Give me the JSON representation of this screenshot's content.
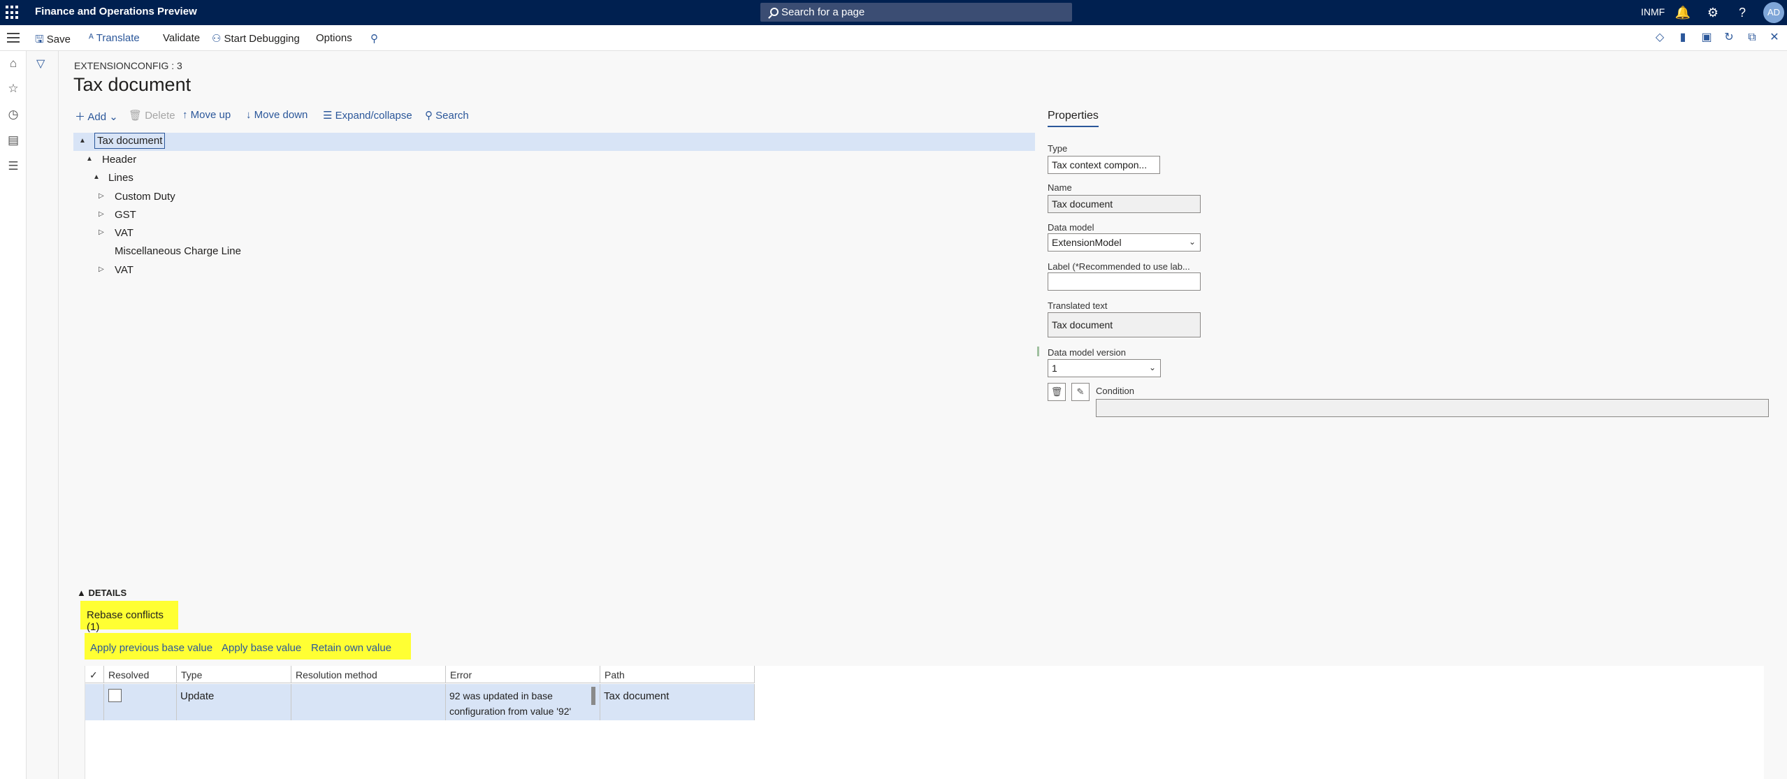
{
  "app": {
    "title": "Finance and Operations Preview",
    "search_placeholder": "Search for a page",
    "company": "INMF",
    "user_initials": "AD"
  },
  "actions": {
    "save": "Save",
    "translate": "Translate",
    "validate": "Validate",
    "start_debugging": "Start Debugging",
    "options": "Options"
  },
  "breadcrumb": "EXTENSIONCONFIG : 3",
  "page_title": "Tax document",
  "tree_toolbar": {
    "add": "Add",
    "delete": "Delete",
    "move_up": "Move up",
    "move_down": "Move down",
    "expand_collapse": "Expand/collapse",
    "search": "Search"
  },
  "tree": [
    {
      "label": "Tax document",
      "expander": "▲",
      "selected": true
    },
    {
      "label": "Header",
      "expander": "▲"
    },
    {
      "label": "Lines",
      "expander": "▲"
    },
    {
      "label": "Custom Duty",
      "expander": "▷"
    },
    {
      "label": "GST",
      "expander": "▷"
    },
    {
      "label": "VAT",
      "expander": "▷"
    },
    {
      "label": "Miscellaneous Charge Line",
      "expander": ""
    },
    {
      "label": "VAT",
      "expander": "▷"
    }
  ],
  "properties": {
    "tab": "Properties",
    "type_label": "Type",
    "type_value": "Tax context compon...",
    "name_label": "Name",
    "name_value": "Tax document",
    "data_model_label": "Data model",
    "data_model_value": "ExtensionModel",
    "label_label": "Label (*Recommended to use lab...",
    "label_value": "",
    "translated_label": "Translated text",
    "translated_value": "Tax document",
    "version_label": "Data model version",
    "version_value": "1",
    "condition_label": "Condition",
    "condition_value": ""
  },
  "details": {
    "header": "DETAILS",
    "tab": "Rebase conflicts (1)",
    "buttons": {
      "apply_previous": "Apply previous base value",
      "apply_base": "Apply base value",
      "retain_own": "Retain own value"
    },
    "columns": {
      "check": "✓",
      "resolved": "Resolved",
      "type": "Type",
      "resolution": "Resolution method",
      "error": "Error",
      "path": "Path"
    },
    "rows": [
      {
        "resolved": false,
        "type": "Update",
        "resolution": "",
        "error": "92 was updated in base configuration from value '92'",
        "path": "Tax document"
      }
    ]
  }
}
